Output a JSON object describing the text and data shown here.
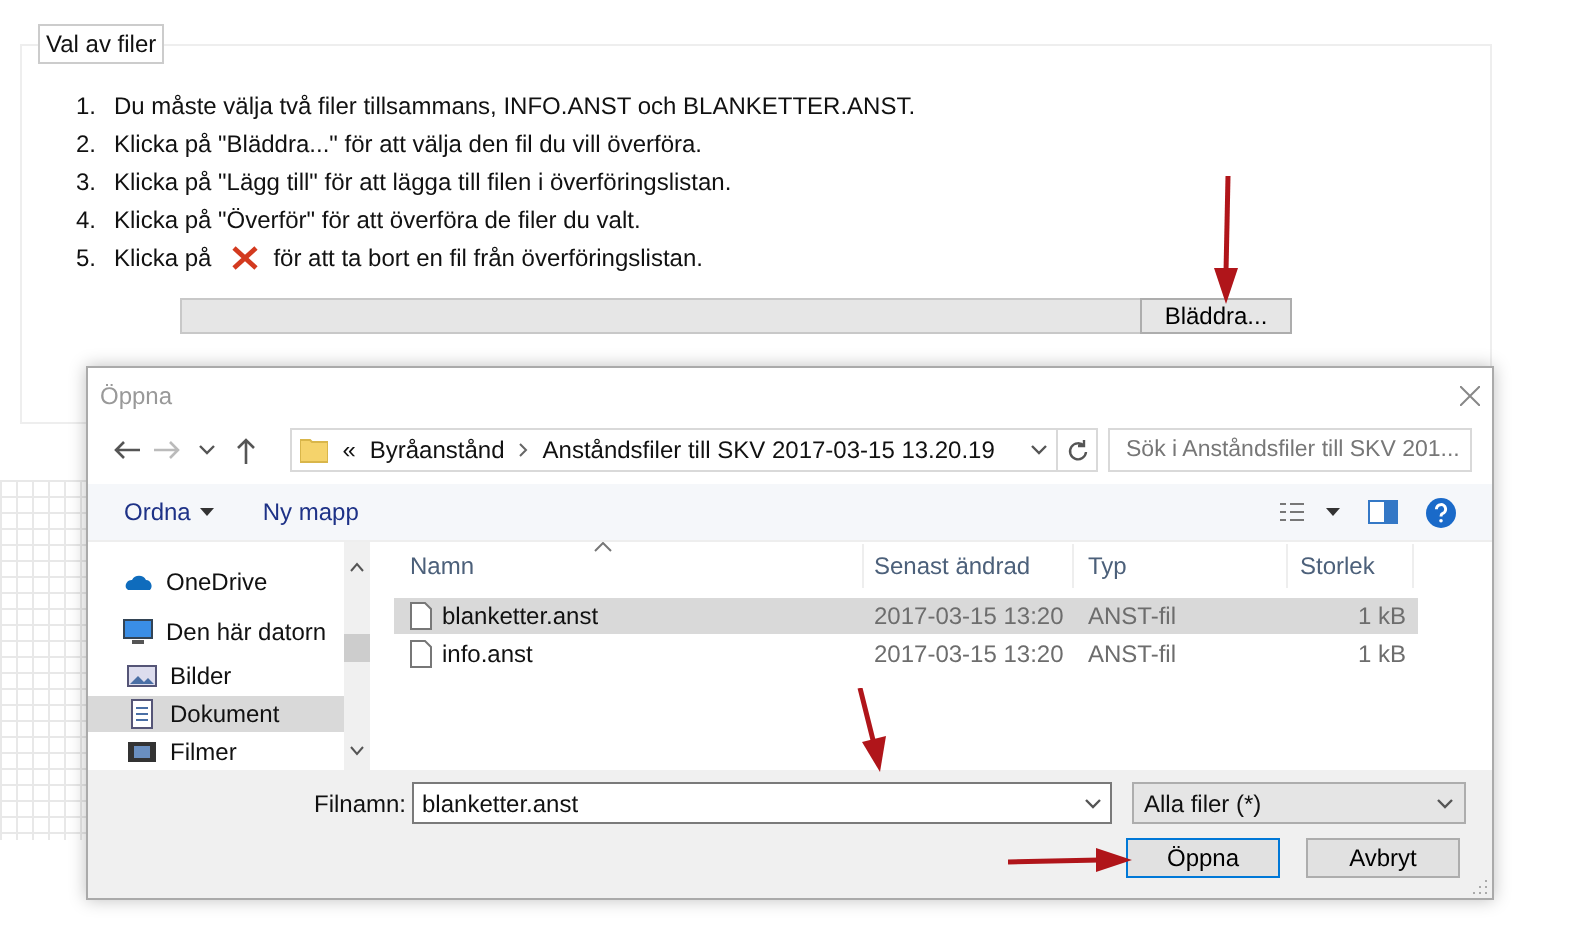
{
  "section": {
    "legend": "Val av filer",
    "steps": [
      {
        "number": "1.",
        "kind": "text",
        "text": "Du måste välja två filer tillsammans, INFO.ANST och BLANKETTER.ANST."
      },
      {
        "number": "2.",
        "kind": "text",
        "text": "Klicka på \"Bläddra...\" för att välja den fil du vill överföra."
      },
      {
        "number": "3.",
        "kind": "text",
        "text": "Klicka på \"Lägg till\" för att lägga till filen i överföringslistan."
      },
      {
        "number": "4.",
        "kind": "text",
        "text": "Klicka på \"Överför\" för att överföra de filer du valt."
      },
      {
        "number": "5.",
        "kind": "with_icon",
        "text_before": "Klicka på",
        "text_after": "för att ta bort en fil från överföringslistan."
      }
    ],
    "file_input": {
      "button": "Bläddra..."
    }
  },
  "dialog": {
    "title": "Öppna",
    "address": {
      "overflow_mark": "«",
      "segments": [
        "Byråanstånd",
        "Anståndsfiler till SKV 2017-03-15 13.20.19"
      ]
    },
    "search": {
      "placeholder": "Sök i Anståndsfiler till SKV 201..."
    },
    "toolbar": [
      {
        "label": "Ordna",
        "kind": "menu"
      },
      {
        "label": "Ny mapp",
        "kind": "button"
      }
    ],
    "nav_items": [
      {
        "label": "OneDrive",
        "kind": "cloud",
        "selected": false
      },
      {
        "label": "Den här datorn",
        "kind": "computer",
        "selected": false,
        "children": [
          {
            "label": "Bilder",
            "kind": "pictures",
            "selected": false
          },
          {
            "label": "Dokument",
            "kind": "documents",
            "selected": true
          },
          {
            "label": "Filmer",
            "kind": "films",
            "selected": false
          }
        ]
      }
    ],
    "columns": [
      "Namn",
      "Senast ändrad",
      "Typ",
      "Storlek"
    ],
    "rows": [
      {
        "name": "blanketter.anst",
        "modified": "2017-03-15 13:20",
        "type": "ANST-fil",
        "size": "1 kB",
        "selected": true
      },
      {
        "name": "info.anst",
        "modified": "2017-03-15 13:20",
        "type": "ANST-fil",
        "size": "1 kB",
        "selected": false
      }
    ],
    "file_name": {
      "label": "Filnamn:",
      "value": "blanketter.anst"
    },
    "filter": {
      "value": "Alla filer (*)"
    },
    "buttons": [
      {
        "label": "Öppna",
        "kind": "default"
      },
      {
        "label": "Avbryt",
        "kind": "normal"
      }
    ]
  }
}
